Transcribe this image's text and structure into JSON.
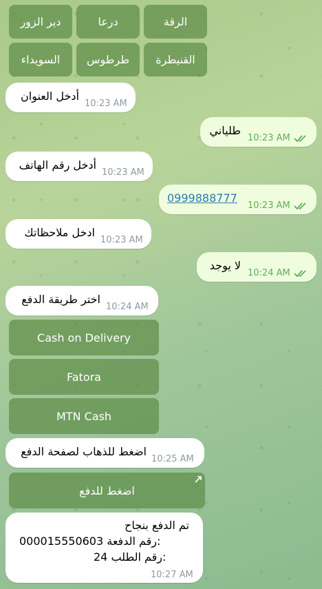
{
  "keyboard_top": {
    "row1": [
      "الرقة",
      "درعا",
      "دير الزور"
    ],
    "row2": [
      "القنيطرة",
      "طرطوس",
      "السويداء"
    ]
  },
  "messages": {
    "m1": {
      "text": "أدخل العنوان",
      "time": "10:23 AM"
    },
    "m2": {
      "text": "طلياني",
      "time": "10:23 AM"
    },
    "m3": {
      "text": "أدخل رقم الهاتف",
      "time": "10:23 AM"
    },
    "m4": {
      "text": "0999888777",
      "time": "10:23 AM"
    },
    "m5": {
      "text": "ادخل ملاحظاتك",
      "time": "10:23 AM"
    },
    "m6": {
      "text": "لا يوجد",
      "time": "10:24 AM"
    },
    "m7": {
      "text": "اختر طريقة الدفع",
      "time": "10:24 AM"
    },
    "m8": {
      "text": "اضغط للذهاب لصفحة الدفع",
      "time": "10:25 AM"
    },
    "m9": {
      "line1": "تم الدفع بنجاح",
      "line2_label": "رقم الدفعة:",
      "line2_value": "000015550603",
      "line3_label": "رقم الطلب:",
      "line3_value": "24",
      "time": "10:27 AM"
    }
  },
  "payment_buttons": [
    "Cash on Delivery",
    "Fatora",
    "MTN Cash"
  ],
  "pay_link_button": "اضغط للدفع"
}
